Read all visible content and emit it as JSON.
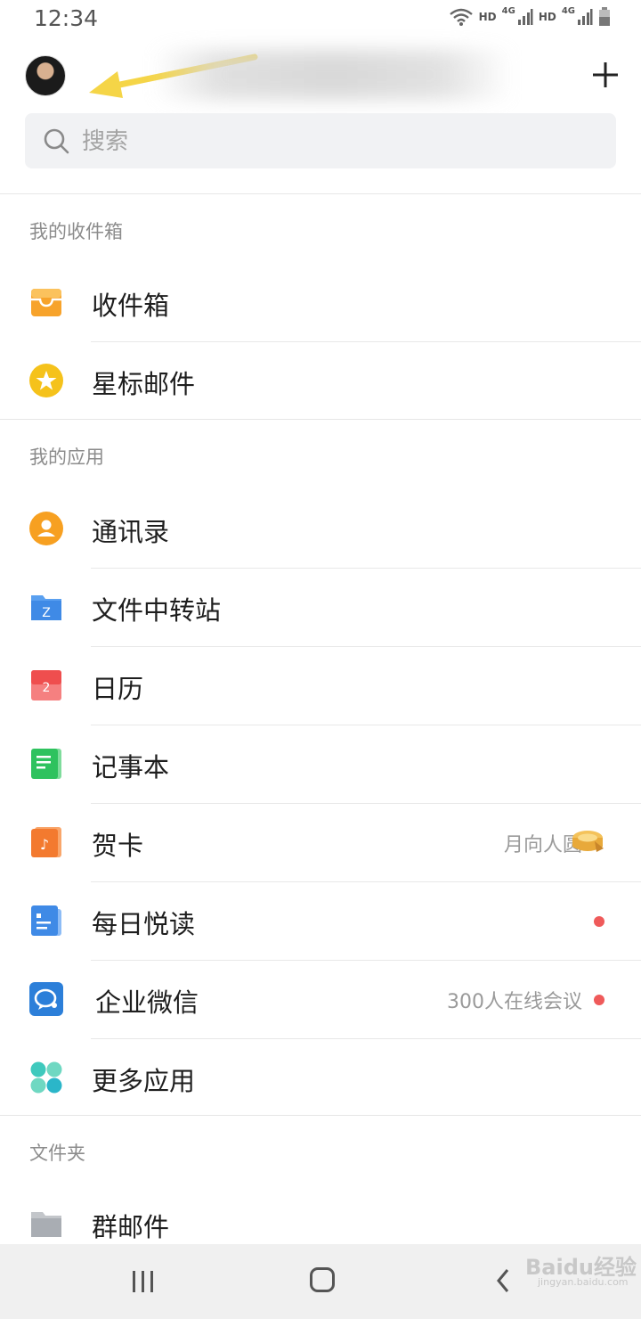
{
  "status_bar": {
    "time": "12:34",
    "hd1": "HD",
    "net1": "4G",
    "hd2": "HD",
    "net2": "4G"
  },
  "header": {
    "avatar_icon": "user-avatar",
    "add_icon": "plus-icon",
    "annotation_arrow_color": "#f5d547"
  },
  "search": {
    "placeholder": "搜索",
    "icon": "search-icon"
  },
  "sections": {
    "inbox": {
      "title": "我的收件箱",
      "items": [
        {
          "label": "收件箱",
          "icon": "inbox-icon",
          "color": "#f7a32b"
        },
        {
          "label": "星标邮件",
          "icon": "star-icon",
          "color": "#f5c21b"
        }
      ]
    },
    "apps": {
      "title": "我的应用",
      "items": [
        {
          "label": "通讯录",
          "icon": "contacts-icon",
          "color": "#f7a021"
        },
        {
          "label": "文件中转站",
          "icon": "folder-transfer-icon",
          "color": "#3f8ae6",
          "glyph": "Z"
        },
        {
          "label": "日历",
          "icon": "calendar-icon",
          "color": "#f25d5d",
          "glyph": "2"
        },
        {
          "label": "记事本",
          "icon": "notebook-icon",
          "color": "#2ec25e"
        },
        {
          "label": "贺卡",
          "icon": "greeting-card-icon",
          "color": "#f37a2f",
          "glyph": "♪",
          "right_text": "月向人圆",
          "right_icon": "mooncake-icon"
        },
        {
          "label": "每日悦读",
          "icon": "daily-reading-icon",
          "color": "#3f8ae6",
          "badge": true
        },
        {
          "label": "企业微信",
          "icon": "wecom-icon",
          "color": "#2c7fd9",
          "right_text": "300人在线会议",
          "badge": true
        },
        {
          "label": "更多应用",
          "icon": "more-apps-icon",
          "color": "#33c7c0"
        }
      ]
    },
    "folders": {
      "title": "文件夹",
      "items": [
        {
          "label": "群邮件",
          "icon": "group-mail-folder-icon",
          "color": "#a9adb3"
        }
      ]
    }
  },
  "nav_bar": {
    "recent_icon": "recent-apps-icon",
    "home_icon": "home-icon",
    "back_icon": "back-icon"
  },
  "watermark": {
    "text": "Baidu经验",
    "sub": "jingyan.baidu.com"
  }
}
